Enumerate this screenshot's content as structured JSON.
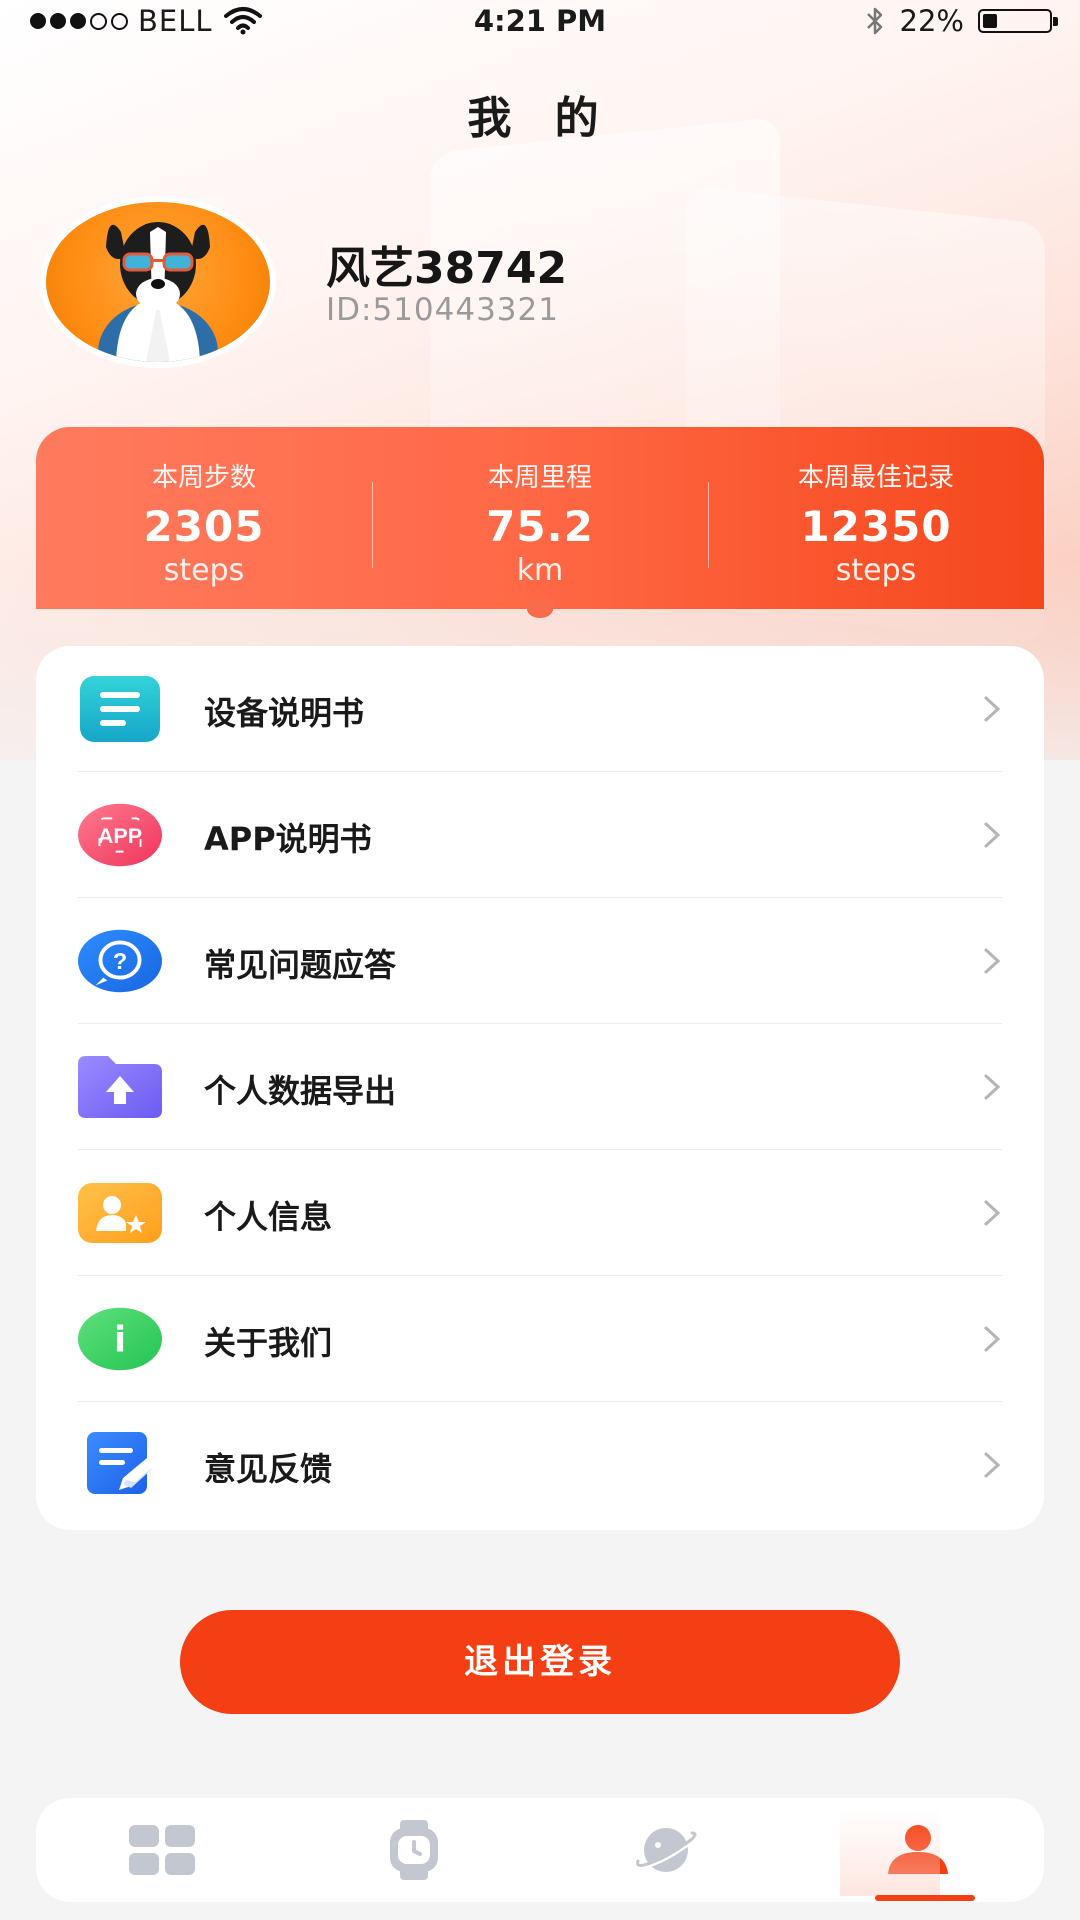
{
  "status_bar": {
    "carrier": "BELL",
    "time": "4:21 PM",
    "battery": "22%",
    "battery_level": 0.22,
    "signal_bars": 3
  },
  "header": {
    "title": "我 的"
  },
  "profile": {
    "name": "风艺38742",
    "id": "ID:510443321"
  },
  "stats": [
    {
      "label": "本周步数",
      "value": "2305",
      "unit": "steps"
    },
    {
      "label": "本周里程",
      "value": "75.2",
      "unit": "km"
    },
    {
      "label": "本周最佳记录",
      "value": "12350",
      "unit": "steps"
    }
  ],
  "menu": [
    {
      "label": "设备说明书",
      "icon": "manual-icon"
    },
    {
      "label": "APP说明书",
      "icon": "app-icon",
      "icon_text": "APP"
    },
    {
      "label": "常见问题应答",
      "icon": "question-icon",
      "icon_text": "?"
    },
    {
      "label": "个人数据导出",
      "icon": "folder-upload-icon"
    },
    {
      "label": "个人信息",
      "icon": "user-star-icon"
    },
    {
      "label": "关于我们",
      "icon": "info-icon",
      "icon_text": "i"
    },
    {
      "label": "意见反馈",
      "icon": "feedback-edit-icon"
    }
  ],
  "logout_label": "退出登录",
  "tabs": [
    {
      "icon": "grid-icon",
      "active": false
    },
    {
      "icon": "watch-icon",
      "active": false
    },
    {
      "icon": "planet-icon",
      "active": false
    },
    {
      "icon": "profile-icon",
      "active": true
    }
  ],
  "colors": {
    "accent": "#f33f13",
    "stats_start": "#ff7b5e",
    "stats_end": "#f5471c",
    "tab_inactive": "#c3c8d0"
  }
}
